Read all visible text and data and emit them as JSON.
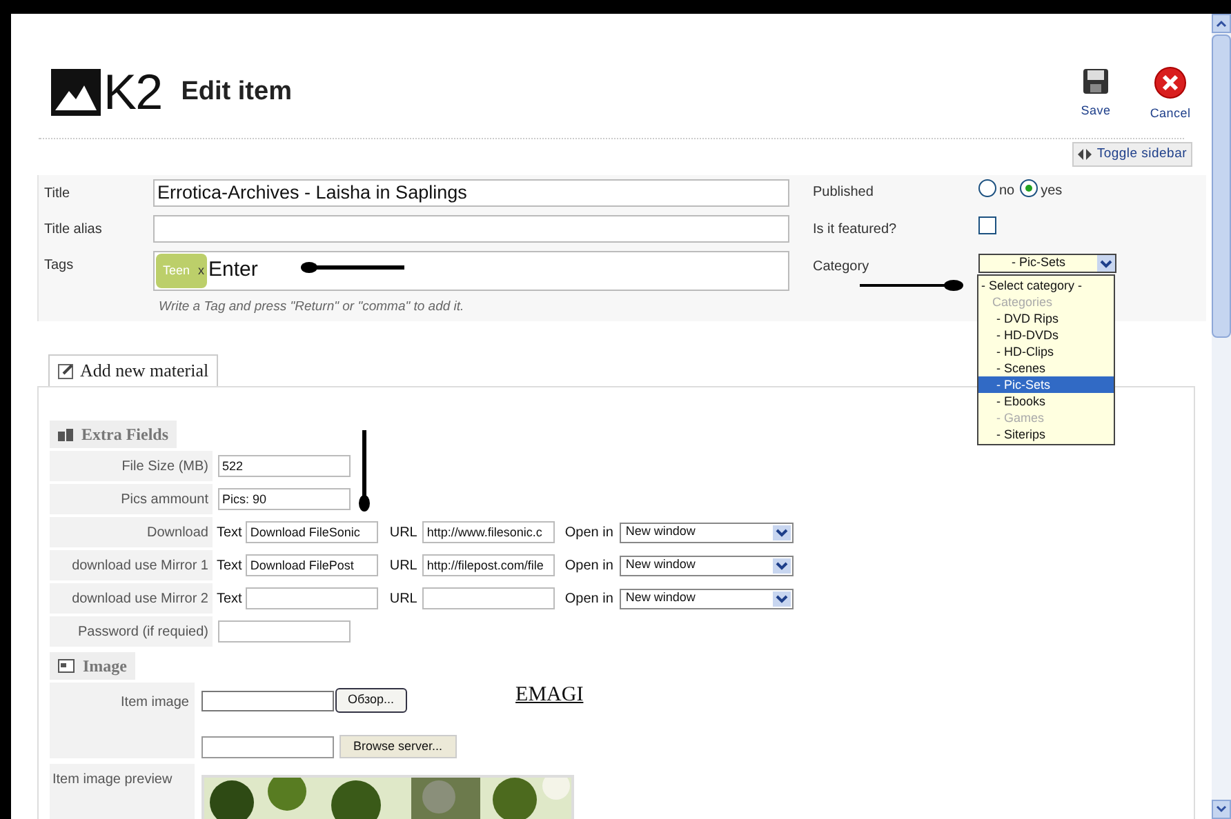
{
  "header": {
    "logo": "K2",
    "title": "Edit item",
    "actions": [
      {
        "kind": "save",
        "label": "Save"
      },
      {
        "kind": "cancel",
        "label": "Cancel"
      }
    ]
  },
  "toggle_sidebar": "Toggle sidebar",
  "main": {
    "title": {
      "label": "Title",
      "value": "Errotica-Archives - Laisha in Saplings"
    },
    "title_alias": {
      "label": "Title alias"
    },
    "tags": {
      "label": "Tags",
      "items": [
        {
          "label": "Teen",
          "remove": "x"
        }
      ],
      "value": "Enter",
      "hint": "Write a Tag and press \"Return\" or \"comma\" to add it."
    }
  },
  "published": {
    "label": "Published",
    "options": [
      {
        "label": "no",
        "selected": false
      },
      {
        "label": "yes",
        "selected": true
      }
    ]
  },
  "featured": {
    "label": "Is it featured?",
    "checked": false
  },
  "category": {
    "label": "Category",
    "value": "- Pic-Sets",
    "expanded": true,
    "options": [
      {
        "label": "- Select category -",
        "disabled": false,
        "selected": false
      },
      {
        "label": "Categories",
        "disabled": true,
        "selected": false
      },
      {
        "label": "- DVD Rips",
        "disabled": false,
        "selected": false
      },
      {
        "label": "- HD-DVDs",
        "disabled": false,
        "selected": false
      },
      {
        "label": "- HD-Clips",
        "disabled": false,
        "selected": false
      },
      {
        "label": "- Scenes",
        "disabled": false,
        "selected": false
      },
      {
        "label": "- Pic-Sets",
        "disabled": false,
        "selected": true
      },
      {
        "label": "- Ebooks",
        "disabled": false,
        "selected": false
      },
      {
        "label": "- Games",
        "disabled": true,
        "selected": false
      },
      {
        "label": "- Siterips",
        "disabled": false,
        "selected": false
      }
    ]
  },
  "tab": {
    "label": "Add new material",
    "selected": true
  },
  "extra_fields": {
    "heading": "Extra Fields",
    "rows": [
      {
        "kind": "text",
        "label": "File Size (MB)",
        "value": "522"
      },
      {
        "kind": "text",
        "label": "Pics ammount",
        "value": "Pics: 90"
      },
      {
        "kind": "link",
        "label": "Download",
        "text_label": "Text",
        "text": "Download FileSonic",
        "url_label": "URL",
        "url": "http://www.filesonic.c",
        "open_label": "Open in",
        "open": "New window"
      },
      {
        "kind": "link",
        "label": "download use Mirror 1",
        "text_label": "Text",
        "text": "Download FilePost",
        "url_label": "URL",
        "url": "http://filepost.com/file",
        "open_label": "Open in",
        "open": "New window"
      },
      {
        "kind": "link",
        "label": "download use Mirror 2",
        "text_label": "Text",
        "url_label": "URL",
        "open_label": "Open in",
        "open": "New window"
      },
      {
        "kind": "text",
        "label": "Password (if requied)"
      }
    ]
  },
  "image": {
    "heading": "Image",
    "item_image_label": "Item image",
    "browse": "Обзор...",
    "browse_server": "Browse server...",
    "note": "EMAGI",
    "preview_label": "Item image preview"
  }
}
